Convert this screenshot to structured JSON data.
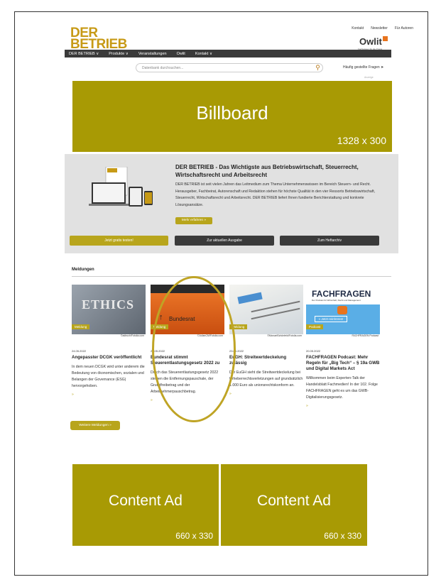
{
  "logo": {
    "line1": "DER",
    "line2": "BETRIEB"
  },
  "toplinks": [
    "Kontakt",
    "Newsletter",
    "Für Autoren"
  ],
  "owlit": {
    "name": "Owlit",
    "sub": "Fachwissen für die Praxis"
  },
  "nav": [
    "DER BETRIEB ∨",
    "Produkte ∨",
    "Veranstaltungen",
    "Owlit",
    "Kontakt ∨"
  ],
  "search": {
    "placeholder": "Datenbank durchsuchen...",
    "faq": "Häufig gestellte Fragen"
  },
  "anzeige": "Anzeige",
  "billboard": {
    "title": "Billboard",
    "size": "1328 x 300"
  },
  "info": {
    "title": "DER BETRIEB - Das Wichtigste aus Betriebswirtschaft, Steuerrecht, Wirtschaftsrecht und Arbeitsrecht",
    "body": "DER BETRIEB ist seit vielen Jahren das Leitmedium zum Thema Unternehmenswissen im Bereich Steuern- und Recht. Herausgeber, Fachbeirat, Autorenschaft und Redaktion stehen für höchste Qualität in den vier Ressorts Betriebswirtschaft, Steuerrecht, Wirtschaftsrecht und Arbeitsrecht. DER BETRIEB liefert Ihnen fundierte Berichterstattung und konkrete Lösungsansätze.",
    "more": "Mehr erfahren »",
    "btn_test": "Jetzt gratis testen!",
    "btn_issue": "Zur aktuellen Ausgabe",
    "btn_archive": "Zum Heftarchiv"
  },
  "meldungen": {
    "heading": "Meldungen",
    "more_button": "Weitere Meldungen »",
    "cards": [
      {
        "badge": "Meldung",
        "credit": "©adiruch/Fotolia.com",
        "date": "24.05.2022",
        "title": "Angepasster DCGK veröffentlicht",
        "text": "In dem neuen DCGK wird unter anderem die Bedeutung von ökonomischen, sozialen und Belangen der Governance (ESG) hervorgehoben.",
        "arrow": "»"
      },
      {
        "badge": "Meldung",
        "credit": "©JulianCM/Fotolia.com",
        "date": "23.05.2022",
        "title": "Bundesrat stimmt Steuerentlastungsgesetz 2022 zu",
        "text": "Durch das Steuerentlastungsgesetz 2022 steigen die Entfernungspauschale, der Grundfreibetrag und der Arbeitnehmerpauschbetrag.",
        "arrow": "»"
      },
      {
        "badge": "Meldung",
        "credit": "©ManuelSchönfeld/Fotolia.com",
        "date": "23.05.2022",
        "title": "EuGH: Streitwertdeckelung zulässig",
        "text": "Der EuGH sieht die Streitwertdeckelung bei Urheberrechtsverletzungen auf grundsätzlich 1.000 Euro als unionsrechtskonform an.",
        "arrow": "»"
      },
      {
        "badge": "Podcast",
        "credit": "FACHFRAGEN Podcast",
        "date": "20.05.2022",
        "title": "FACHFRAGEN Podcast: Mehr Regeln für „Big Tech“ – § 19a GWB und Digital Markets Act",
        "text": "Willkommen beim Experten-Talk der Handelsblatt Fachmedien! In der 102. Folge FACHFRAGEN geht es um das GWB-Digitalisierungsgesetz.",
        "arrow": "»"
      }
    ]
  },
  "images": {
    "ethics": "ETHICS",
    "bundesrat": "Bundesrat",
    "fachfragen_logo": "FACHFRAGEN",
    "fachfragen_sub": "Der Podcast für Wirtschaft, Recht und Management",
    "fachfragen_cta": "» Jetzt reinhören!"
  },
  "content_ads": [
    {
      "title": "Content Ad",
      "size": "660 x 330"
    },
    {
      "title": "Content Ad",
      "size": "660 x 330"
    }
  ],
  "colors": {
    "accent": "#a89a04",
    "button": "#b8a51c",
    "nav": "#3a3a3a",
    "highlight": "#bfa425"
  }
}
